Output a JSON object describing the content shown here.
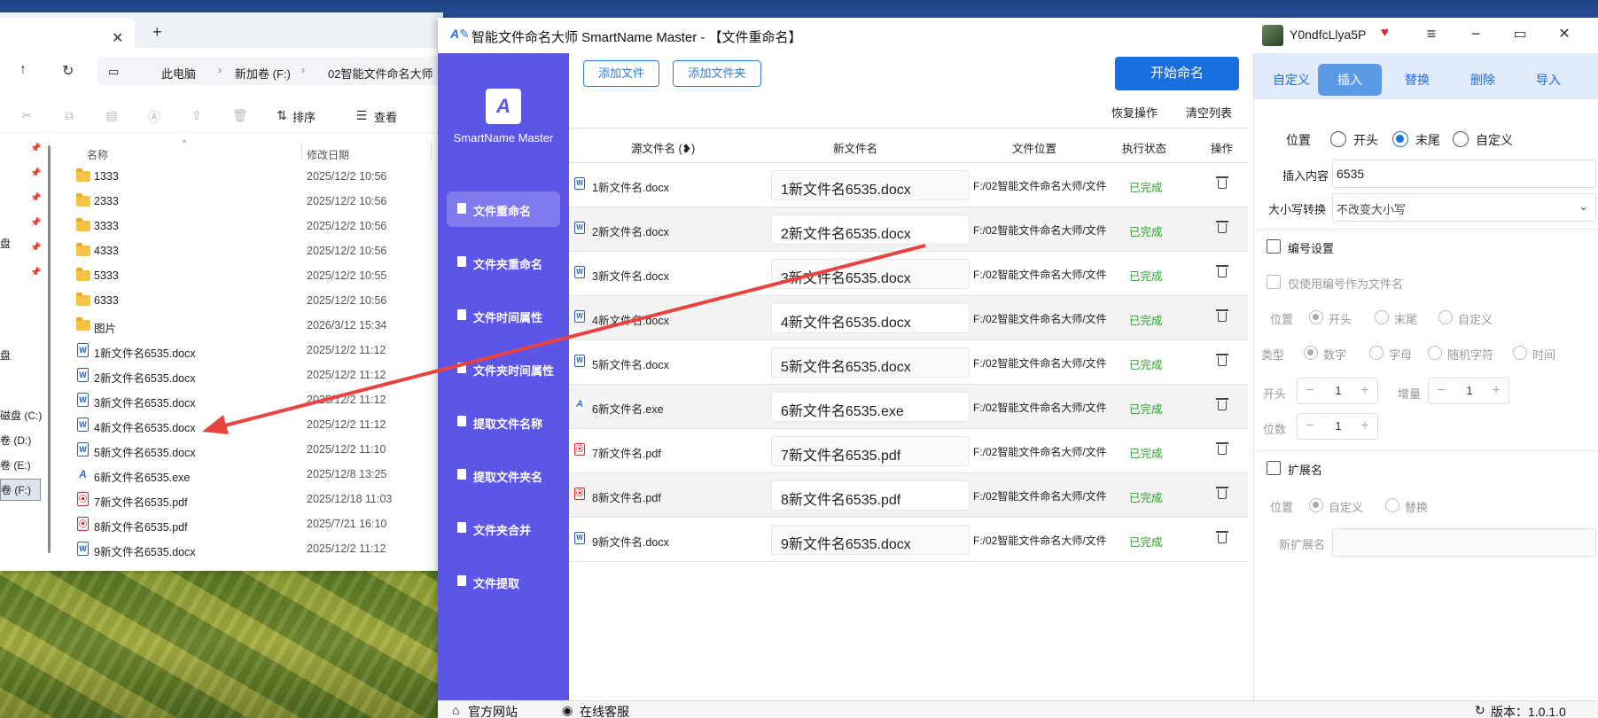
{
  "explorer": {
    "breadcrumb": [
      "此电脑",
      "新加卷 (F:)",
      "02智能文件命名大师"
    ],
    "toolbar": {
      "sort": "排序",
      "view": "查看"
    },
    "columns": {
      "name": "名称",
      "date": "修改日期"
    },
    "drives": [
      {
        "label": "盘"
      },
      {
        "label": "盘"
      },
      {
        "label": "磁盘 (C:)"
      },
      {
        "label": "卷 (D:)"
      },
      {
        "label": "卷 (E:)"
      },
      {
        "label": "卷 (F:)"
      }
    ],
    "files": [
      {
        "name": "1333",
        "date": "2025/12/2 10:56",
        "type": "folder"
      },
      {
        "name": "2333",
        "date": "2025/12/2 10:56",
        "type": "folder"
      },
      {
        "name": "3333",
        "date": "2025/12/2 10:56",
        "type": "folder"
      },
      {
        "name": "4333",
        "date": "2025/12/2 10:56",
        "type": "folder"
      },
      {
        "name": "5333",
        "date": "2025/12/2 10:55",
        "type": "folder"
      },
      {
        "name": "6333",
        "date": "2025/12/2 10:56",
        "type": "folder"
      },
      {
        "name": "图片",
        "date": "2026/3/12 15:34",
        "type": "folder"
      },
      {
        "name": "1新文件名6535.docx",
        "date": "2025/12/2 11:12",
        "type": "docx"
      },
      {
        "name": "2新文件名6535.docx",
        "date": "2025/12/2 11:12",
        "type": "docx"
      },
      {
        "name": "3新文件名6535.docx",
        "date": "2025/12/2 11:12",
        "type": "docx"
      },
      {
        "name": "4新文件名6535.docx",
        "date": "2025/12/2 11:12",
        "type": "docx"
      },
      {
        "name": "5新文件名6535.docx",
        "date": "2025/12/2 11:10",
        "type": "docx"
      },
      {
        "name": "6新文件名6535.exe",
        "date": "2025/12/8 13:25",
        "type": "exe"
      },
      {
        "name": "7新文件名6535.pdf",
        "date": "2025/12/18 11:03",
        "type": "pdf"
      },
      {
        "name": "8新文件名6535.pdf",
        "date": "2025/7/21 16:10",
        "type": "pdf"
      },
      {
        "name": "9新文件名6535.docx",
        "date": "2025/12/2 11:12",
        "type": "docx"
      }
    ]
  },
  "app": {
    "title": "智能文件命名大师 SmartName Master - 【文件重命名】",
    "username": "Y0ndfcLlya5P",
    "logo_text": "SmartName Master",
    "nav": [
      "文件重命名",
      "文件夹重命名",
      "文件时间属性",
      "文件夹时间属性",
      "提取文件名称",
      "提取文件夹名",
      "文件夹合并",
      "文件提取"
    ],
    "buttons": {
      "add_file": "添加文件",
      "add_folder": "添加文件夹",
      "start": "开始命名",
      "restore": "恢复操作",
      "clear": "清空列表"
    },
    "table": {
      "headers": {
        "src": "源文件名 (❥)",
        "new": "新文件名",
        "loc": "文件位置",
        "status": "执行状态",
        "op": "操作"
      },
      "rows": [
        {
          "src": "1新文件名.docx",
          "new": "1新文件名6535.docx",
          "loc": "F:/02智能文件命名大师/文件",
          "status": "已完成",
          "type": "docx"
        },
        {
          "src": "2新文件名.docx",
          "new": "2新文件名6535.docx",
          "loc": "F:/02智能文件命名大师/文件",
          "status": "已完成",
          "type": "docx"
        },
        {
          "src": "3新文件名.docx",
          "new": "3新文件名6535.docx",
          "loc": "F:/02智能文件命名大师/文件",
          "status": "已完成",
          "type": "docx"
        },
        {
          "src": "4新文件名.docx",
          "new": "4新文件名6535.docx",
          "loc": "F:/02智能文件命名大师/文件",
          "status": "已完成",
          "type": "docx"
        },
        {
          "src": "5新文件名.docx",
          "new": "5新文件名6535.docx",
          "loc": "F:/02智能文件命名大师/文件",
          "status": "已完成",
          "type": "docx"
        },
        {
          "src": "6新文件名.exe",
          "new": "6新文件名6535.exe",
          "loc": "F:/02智能文件命名大师/文件",
          "status": "已完成",
          "type": "exe"
        },
        {
          "src": "7新文件名.pdf",
          "new": "7新文件名6535.pdf",
          "loc": "F:/02智能文件命名大师/文件",
          "status": "已完成",
          "type": "pdf"
        },
        {
          "src": "8新文件名.pdf",
          "new": "8新文件名6535.pdf",
          "loc": "F:/02智能文件命名大师/文件",
          "status": "已完成",
          "type": "pdf"
        },
        {
          "src": "9新文件名.docx",
          "new": "9新文件名6535.docx",
          "loc": "F:/02智能文件命名大师/文件",
          "status": "已完成",
          "type": "docx"
        }
      ]
    },
    "right_tabs": [
      "自定义",
      "插入",
      "替换",
      "删除",
      "导入"
    ],
    "insert": {
      "position_label": "位置",
      "position_options": [
        "开头",
        "末尾",
        "自定义"
      ],
      "position_selected": "末尾",
      "content_label": "插入内容",
      "content_value": "6535",
      "case_label": "大小写转换",
      "case_value": "不改变大小写",
      "numbering_label": "编号设置",
      "only_number_label": "仅使用编号作为文件名",
      "num_position_label": "位置",
      "num_position_options": [
        "开头",
        "末尾",
        "自定义"
      ],
      "type_label": "类型",
      "type_options": [
        "数字",
        "字母",
        "随机字符",
        "时间"
      ],
      "start_label": "开头",
      "start_value": "1",
      "increment_label": "增量",
      "increment_value": "1",
      "digits_label": "位数",
      "digits_value": "1",
      "ext_label": "扩展名",
      "ext_position_label": "位置",
      "ext_position_options": [
        "自定义",
        "替换"
      ],
      "new_ext_label": "新扩展名"
    },
    "footer": {
      "website": "官方网站",
      "support": "在线客服",
      "version": "版本：1.0.1.0"
    }
  },
  "colors": {
    "sidebar": "#5b55e8",
    "primary": "#1a6fdf",
    "success": "#2ba02b",
    "arrow": "#e8433f"
  }
}
